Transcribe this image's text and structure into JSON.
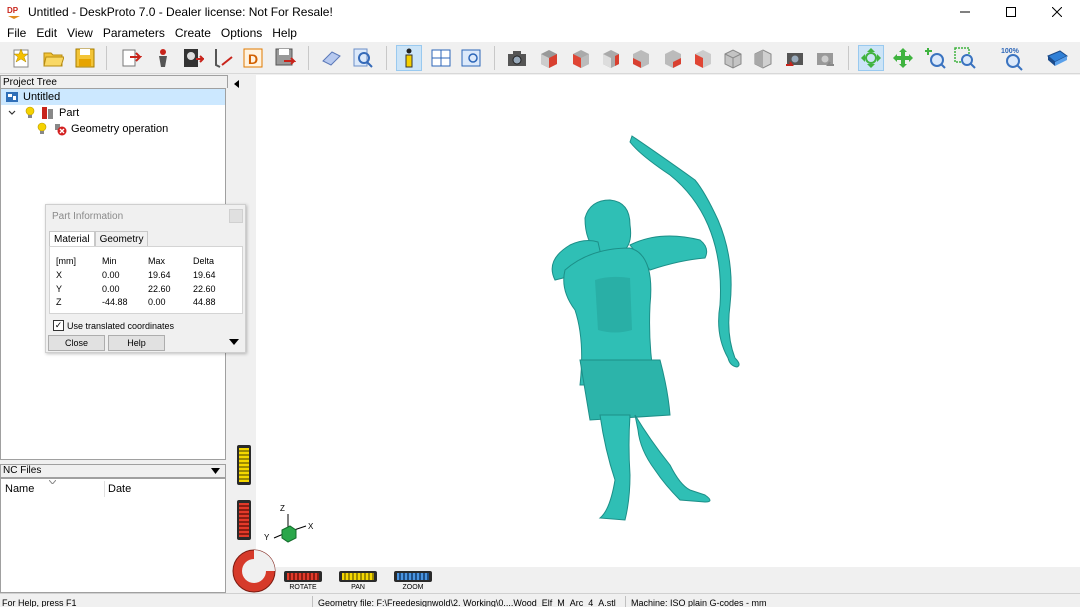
{
  "window": {
    "title": "Untitled - DeskProto 7.0 - Dealer license: Not For Resale!",
    "app_icon_text": "DP"
  },
  "menu": [
    "File",
    "Edit",
    "View",
    "Parameters",
    "Create",
    "Options",
    "Help"
  ],
  "toolbar": {
    "zoom_label": "100%"
  },
  "project_tree": {
    "header": "Project Tree",
    "items": [
      {
        "label": "Untitled"
      },
      {
        "label": "Part"
      },
      {
        "label": "Geometry operation"
      }
    ]
  },
  "nc_files": {
    "header": "NC Files",
    "columns": [
      "Name",
      "Date"
    ]
  },
  "part_info": {
    "title": "Part Information",
    "tabs": [
      "Material",
      "Geometry"
    ],
    "active_tab": "Material",
    "table": {
      "headers": [
        "[mm]",
        "Min",
        "Max",
        "Delta"
      ],
      "rows": [
        [
          "X",
          "0.00",
          "19.64",
          "19.64"
        ],
        [
          "Y",
          "0.00",
          "22.60",
          "22.60"
        ],
        [
          "Z",
          "-44.88",
          "0.00",
          "44.88"
        ]
      ]
    },
    "checkbox_label": "Use translated coordinates",
    "checkbox_checked": true,
    "close_label": "Close",
    "help_label": "Help"
  },
  "viewport": {
    "model_color": "#2fbfb5",
    "axis_labels": {
      "x": "X",
      "y": "Y",
      "z": "Z"
    },
    "modes": [
      {
        "label": "ROTATE",
        "color": "#d23b2b"
      },
      {
        "label": "PAN",
        "color": "#d8c21f"
      },
      {
        "label": "ZOOM",
        "color": "#3f86cf"
      }
    ]
  },
  "status": {
    "help": "For Help, press F1",
    "geometry": "Geometry file: F:\\Freedesignwold\\2. Working\\0....Wood_Elf_M_Arc_4_A.stl",
    "machine": "Machine: ISO plain G-codes - mm"
  }
}
